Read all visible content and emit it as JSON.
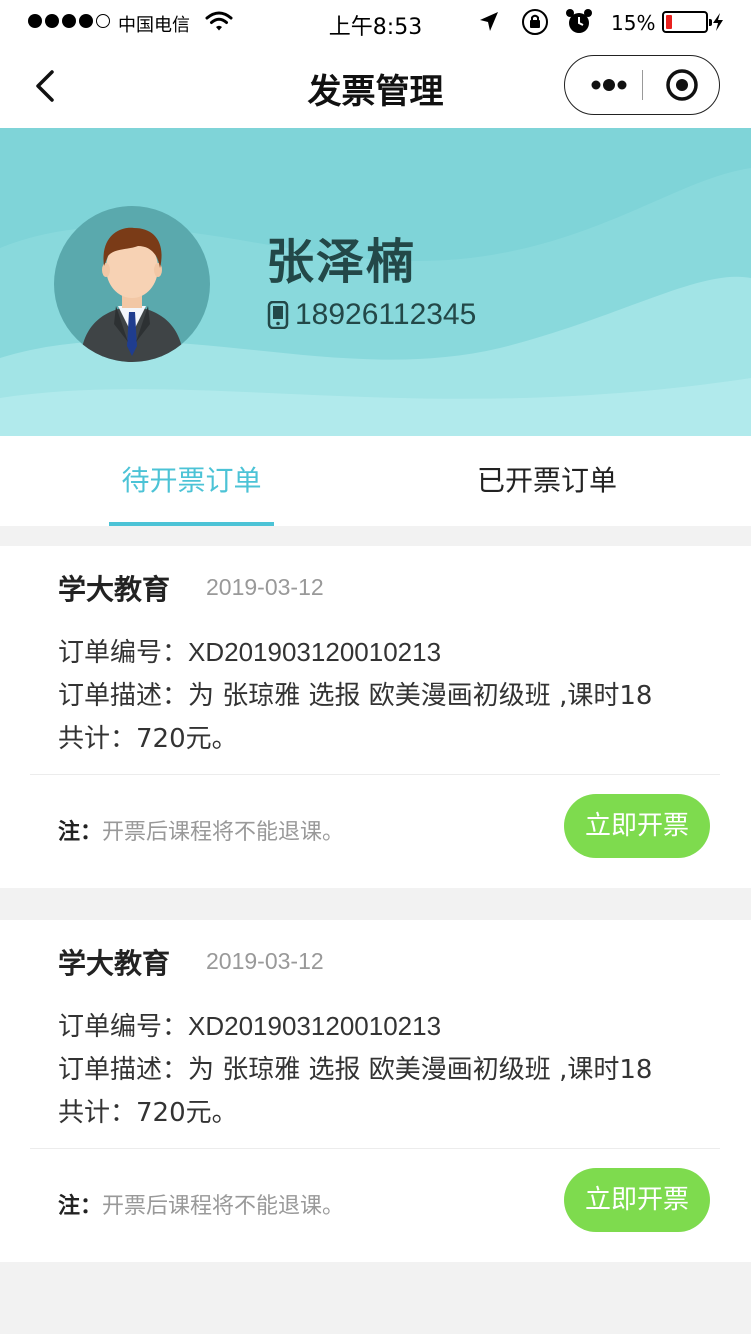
{
  "status_bar": {
    "carrier": "中国电信",
    "time": "上午8:53",
    "battery_percent_text": "15%",
    "battery_level": 0.15,
    "battery_color": "#e8211e",
    "icons": [
      "signal-dots-icon",
      "wifi-icon",
      "location-arrow-icon",
      "rotation-lock-icon",
      "alarm-clock-icon",
      "battery-icon",
      "charging-bolt-icon"
    ]
  },
  "nav": {
    "title": "发票管理",
    "icons": [
      "back-chevron-icon",
      "more-dots-icon",
      "close-target-icon"
    ]
  },
  "profile": {
    "name": "张泽楠",
    "phone": "18926112345",
    "header_color": "#7fd4d8",
    "icons": [
      "avatar-man-icon",
      "phone-icon"
    ]
  },
  "tabs": [
    {
      "label": "待开票订单",
      "active": true
    },
    {
      "label": "已开票订单",
      "active": false
    }
  ],
  "accent_color": "#4cc3d6",
  "button_color": "#7edb4e",
  "orders": [
    {
      "org": "学大教育",
      "date": "2019-03-12",
      "order_no_label": "订单编号：",
      "order_no": "XD201903120010213",
      "desc_label": "订单描述：",
      "desc": "为 张琼雅 选报 欧美漫画初级班 ,课时18",
      "total_label": "共计：",
      "total": "720元。",
      "note_label": "注：",
      "note": "开票后课程将不能退课。",
      "button": "立即开票"
    },
    {
      "org": "学大教育",
      "date": "2019-03-12",
      "order_no_label": "订单编号：",
      "order_no": "XD201903120010213",
      "desc_label": "订单描述：",
      "desc": "为 张琼雅 选报 欧美漫画初级班 ,课时18",
      "total_label": "共计：",
      "total": "720元。",
      "note_label": "注：",
      "note": "开票后课程将不能退课。",
      "button": "立即开票"
    }
  ]
}
